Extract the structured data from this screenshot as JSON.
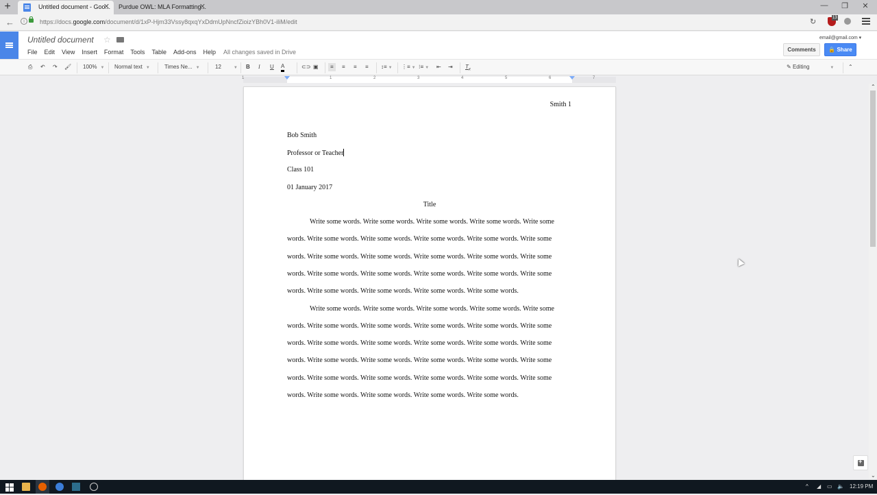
{
  "browser": {
    "tabs": [
      {
        "title": "Untitled document - Goo...",
        "active": true
      },
      {
        "title": "Purdue OWL: MLA Formatting...",
        "active": false
      }
    ],
    "url_prefix": "https://docs.",
    "url_domain": "google.com",
    "url_path": "/document/d/1xP-Hjm33Vssy8qxqYxDdmUpNncfZioizYBh0V1-iliM/edit",
    "extension_badge": "13",
    "window_controls": {
      "minimize": "—",
      "restore": "❐",
      "close": "✕"
    }
  },
  "docs": {
    "title": "Untitled document",
    "menu": [
      "File",
      "Edit",
      "View",
      "Insert",
      "Format",
      "Tools",
      "Table",
      "Add-ons",
      "Help"
    ],
    "save_status": "All changes saved in Drive",
    "account_email": "email@gmail.com",
    "comments_label": "Comments",
    "share_label": "Share",
    "toolbar": {
      "zoom": "100%",
      "style": "Normal text",
      "font": "Times Ne...",
      "font_size": "12",
      "bold": "B",
      "italic": "I",
      "underline": "U",
      "text_color": "A",
      "mode": "Editing"
    },
    "ruler_numbers": [
      "1",
      "1",
      "2",
      "3",
      "4",
      "5",
      "6",
      "7"
    ]
  },
  "document": {
    "header": "Smith 1",
    "lines": [
      "Bob Smith",
      "Professor or Teacher",
      "Class 101",
      "01 January 2017"
    ],
    "title": "Title",
    "paragraphs": [
      [
        "Write some words. Write some words. Write some words. Write some words. Write some",
        "words. Write some words. Write some words. Write some words. Write some words. Write some",
        "words. Write some words. Write some words. Write some words. Write some words. Write some",
        "words. Write some words. Write some words. Write some words. Write some words. Write some",
        "words. Write some words. Write some words. Write some words. Write some words."
      ],
      [
        "Write some words. Write some words. Write some words. Write some words. Write some",
        "words. Write some words. Write some words. Write some words. Write some words. Write some",
        "words. Write some words. Write some words. Write some words. Write some words. Write some",
        "words. Write some words. Write some words. Write some words. Write some words. Write some",
        "words. Write some words. Write some words. Write some words. Write some words. Write some",
        "words. Write some words. Write some words. Write some words. Write some words."
      ]
    ]
  },
  "taskbar": {
    "time": "12:19 PM",
    "apps": [
      "start",
      "file-explorer",
      "firefox",
      "browser",
      "media-app",
      "chrome"
    ]
  }
}
